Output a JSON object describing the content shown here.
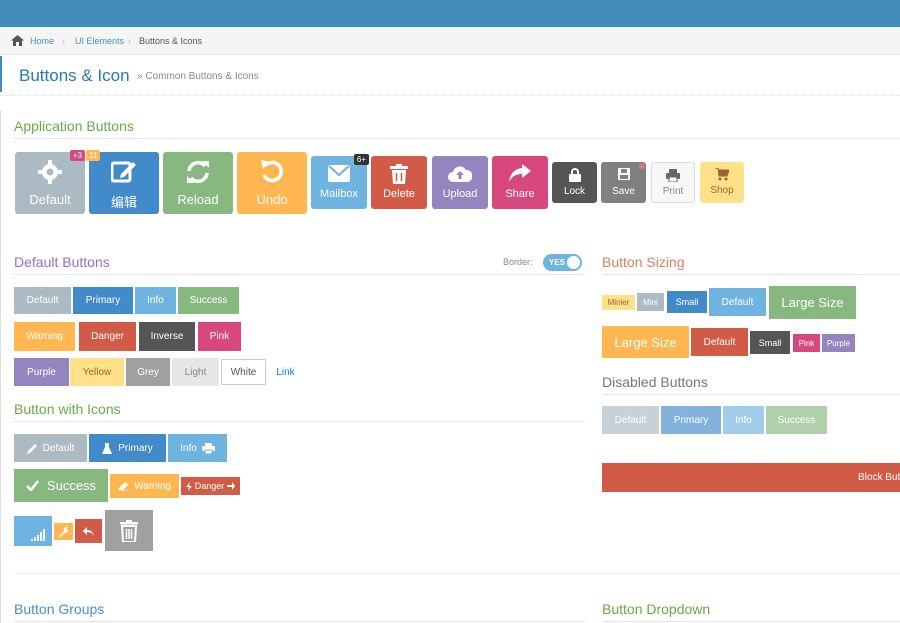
{
  "breadcrumbs": {
    "home": "Home",
    "ui": "UI Elements",
    "current": "Buttons & Icons"
  },
  "page": {
    "title": "Buttons & Icon",
    "subtitle": "» Common Buttons & Icons"
  },
  "sections": {
    "app": "Application Buttons",
    "default": "Default Buttons",
    "sizing": "Button Sizing",
    "disabled": "Disabled Buttons",
    "icons": "Button with Icons",
    "groups": "Button Groups",
    "dropdown": "Button Dropdown"
  },
  "border_label": "Border:",
  "border_toggle": "YES",
  "app_buttons": {
    "default": "Default",
    "default_badge": "+3",
    "edit": "编辑",
    "edit_badge": "11",
    "reload": "Reload",
    "undo": "Undo",
    "mailbox": "Mailbox",
    "mailbox_badge": "6+",
    "delete": "Delete",
    "upload": "Upload",
    "share": "Share",
    "lock": "Lock",
    "save": "Save",
    "print": "Print",
    "shop": "Shop"
  },
  "default_buttons": {
    "row1": [
      "Default",
      "Primary",
      "Info",
      "Success"
    ],
    "row2": [
      "Warning",
      "Danger",
      "Inverse",
      "Pink"
    ],
    "row3": [
      "Purple",
      "Yellow",
      "Grey",
      "Light",
      "White",
      "Link"
    ]
  },
  "sizing": {
    "row1": [
      "Minier",
      "Mini",
      "Small",
      "Default",
      "Large Size"
    ],
    "row2": [
      "Large Size",
      "Default",
      "Small",
      "Pink",
      "Purple"
    ]
  },
  "disabled": [
    "Default",
    "Primary",
    "Info",
    "Success"
  ],
  "icon_buttons": {
    "default": "Default",
    "primary": "Primary",
    "info": "Info",
    "success": "Success",
    "warning": "Warning",
    "danger": "Danger"
  },
  "block_button": "Block Butt"
}
